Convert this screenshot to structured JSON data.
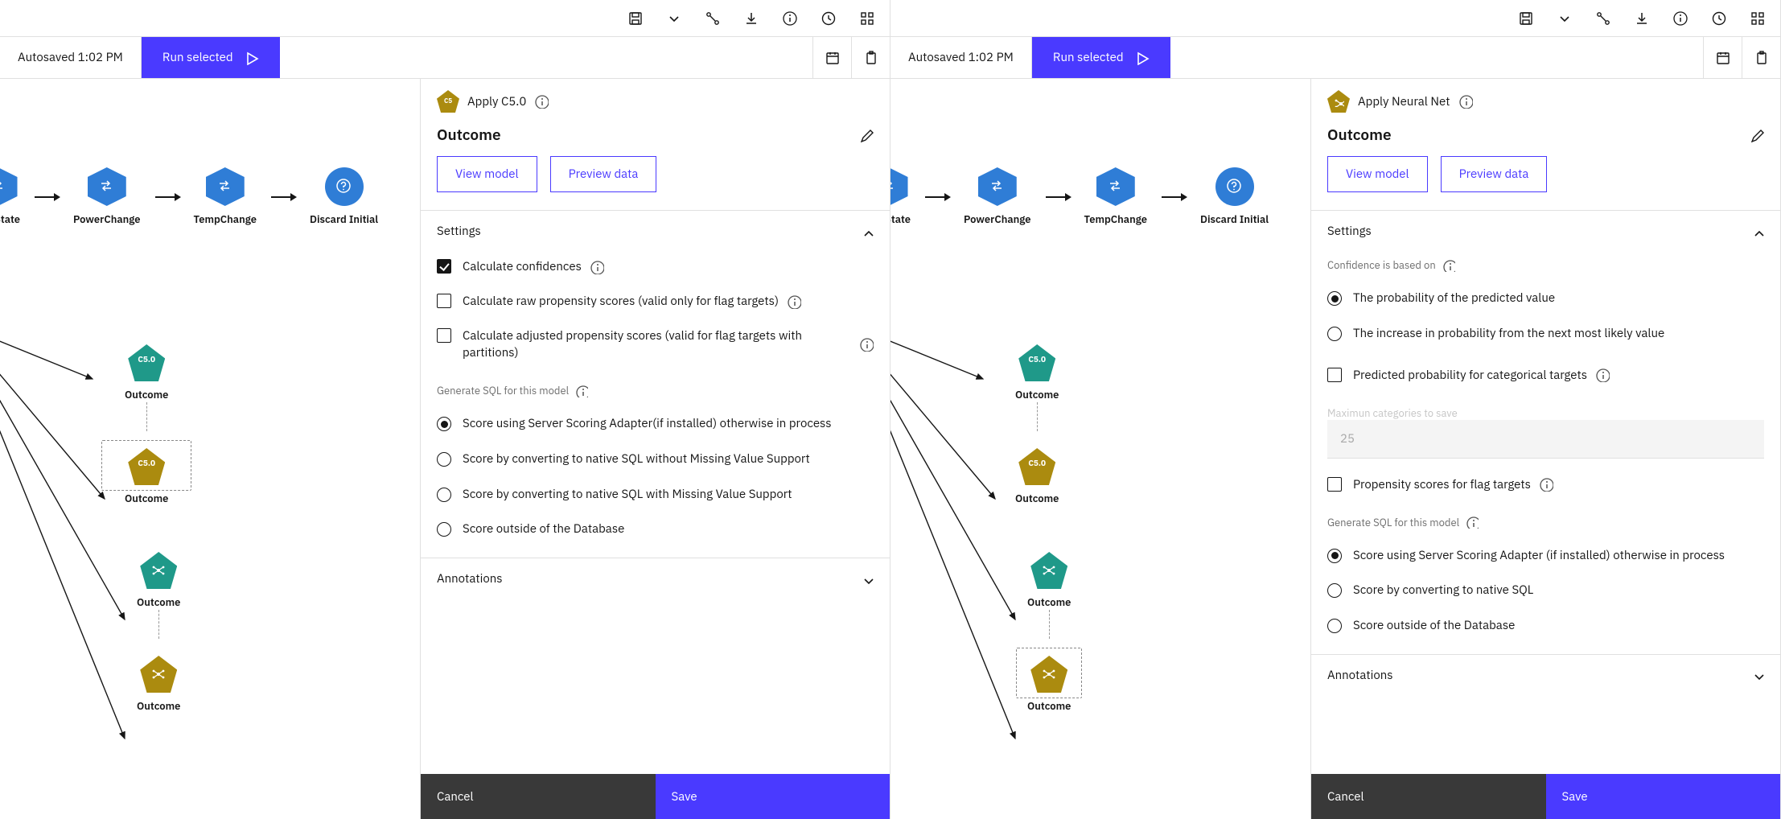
{
  "left": {
    "autosave": "Autosaved 1:02 PM",
    "run": "Run selected",
    "apply_label": "Apply C5.0",
    "outcome_title": "Outcome",
    "view_model": "View model",
    "preview_data": "Preview data",
    "settings_title": "Settings",
    "chk_confidences": "Calculate confidences",
    "chk_raw": "Calculate raw propensity scores (valid only for flag targets)",
    "chk_adj": "Calculate adjusted propensity scores (valid for flag targets with partitions)",
    "gen_sql": "Generate SQL for this model",
    "radio_scoring_adapter": "Score using Server Scoring Adapter(if installed) otherwise in process",
    "radio_native_nomiss": "Score by converting to native SQL without Missing Value Support",
    "radio_native_miss": "Score by converting to native SQL with Missing Value Support",
    "radio_outside": "Score outside of the Database",
    "annotations_title": "Annotations",
    "cancel": "Cancel",
    "save": "Save"
  },
  "right": {
    "autosave": "Autosaved 1:02 PM",
    "run": "Run selected",
    "apply_label": "Apply Neural Net",
    "outcome_title": "Outcome",
    "view_model": "View model",
    "preview_data": "Preview data",
    "settings_title": "Settings",
    "conf_based": "Confidence is based on",
    "radio_prob_pred": "The probability of the predicted value",
    "radio_inc_prob": "The increase in probability from the next most likely value",
    "chk_pred_prob": "Predicted probability for categorical targets",
    "max_cat_label": "Maximun categories to save",
    "max_cat_value": "25",
    "chk_propensity": "Propensity scores for flag targets",
    "gen_sql": "Generate SQL for this model",
    "radio_scoring_adapter": "Score using Server Scoring Adapter (if installed) otherwise in process",
    "radio_native": "Score by converting to native SQL",
    "radio_outside": "Score outside of the Database",
    "annotations_title": "Annotations",
    "cancel": "Cancel",
    "save": "Save"
  },
  "flow": {
    "n1": "werState",
    "n2": "PowerChange",
    "n3": "TempChange",
    "n4": "Discard Initial",
    "c50_badge": "C5.0",
    "outcome": "Outcome"
  }
}
